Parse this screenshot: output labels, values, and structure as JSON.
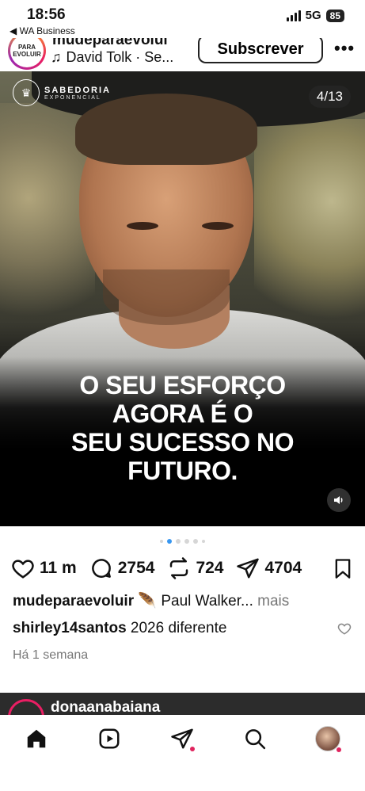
{
  "status_bar": {
    "time": "18:56",
    "back_label": "◀ WA Business",
    "network": "5G",
    "battery": "85"
  },
  "post": {
    "account": "mudeparaevolui",
    "avatar_text": "PARA EVOLUIR",
    "music": "David Tolk · Se...",
    "subscribe_label": "Subscrever",
    "brand_name": "SABEDORIA",
    "brand_sub": "EXPONENCIAL",
    "slide_counter": "4/13",
    "quote_lines": [
      "O SEU ESFORÇO",
      "AGORA É O",
      "SEU SUCESSO NO",
      "FUTURO."
    ],
    "likes": "11 m",
    "comments": "2754",
    "reposts": "724",
    "shares": "4704",
    "caption_user": "mudeparaevoluir",
    "caption_text": "Paul Walker...",
    "caption_more": "mais",
    "comment_user": "shirley14santos",
    "comment_text": "2026 diferente",
    "time_ago": "Há 1 semana",
    "carousel": {
      "count": 6,
      "active_index": 1
    }
  },
  "next_post": {
    "account": "donaanabaiana"
  },
  "colors": {
    "accent": "#3897f0",
    "notification": "#e0245e"
  }
}
